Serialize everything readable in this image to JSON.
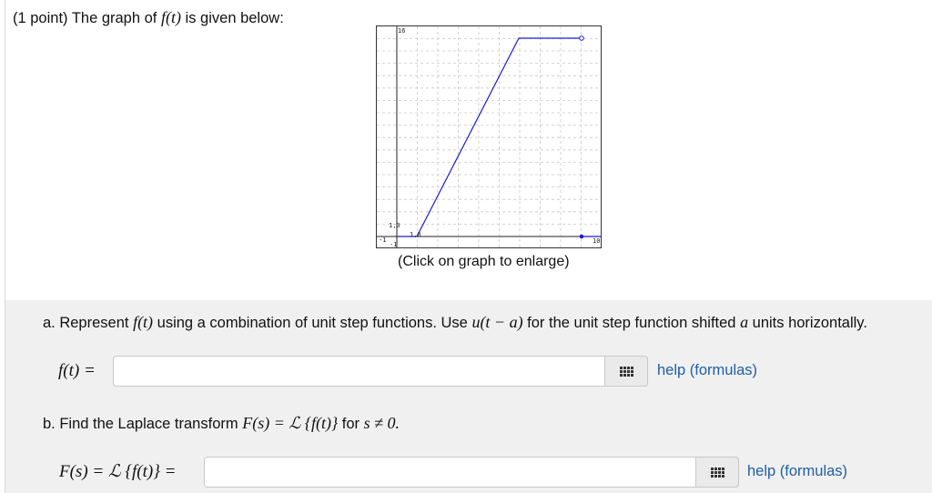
{
  "header": {
    "points": "(1 point)",
    "text_before": " The graph of ",
    "func": "f(t)",
    "text_after": " is given below:"
  },
  "graph": {
    "caption": "(Click on graph to enlarge)",
    "tick_labels": {
      "y_top": "16",
      "y_one": "1,0",
      "x_one": "1,0",
      "x_right": "10",
      "x_left": "-1",
      "y_bottom": "-1"
    },
    "line_color": "#1c1cd6"
  },
  "part_a": {
    "prefix": "a. Represent ",
    "func": "f(t)",
    "mid": " using a combination of unit step functions. Use ",
    "step": "u(t − a)",
    "mid2": " for the unit step function shifted ",
    "var": "a",
    "suffix": " units horizontally.",
    "label": "f(t) =",
    "input_value": "",
    "help_text": "help (formulas)"
  },
  "part_b": {
    "prefix": "b. Find the Laplace transform ",
    "formula": "F(s) = ℒ {f(t)}",
    "mid": " for ",
    "cond": "s ≠ 0.",
    "label": "F(s) = ℒ {f(t)} =",
    "input_value": "",
    "help_text": "help (formulas)"
  }
}
